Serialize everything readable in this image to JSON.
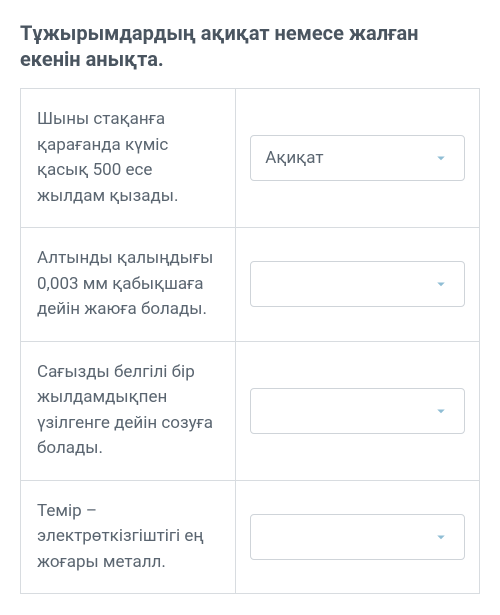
{
  "heading": "Тұжырымдардың ақиқат немесе жалған екенін анықта.",
  "rows": [
    {
      "text": "Шыны стақанға қарағанда күміс қасық 500 есе жылдам қызады.",
      "selected": "Ақиқат"
    },
    {
      "text": "Алтынды қалыңдығы 0,003 мм қабықшаға дейін жаюға болады.",
      "selected": ""
    },
    {
      "text": "Сағызды белгілі бір жылдамдықпен үзілгенге дейін созуға болады.",
      "selected": ""
    },
    {
      "text": "Темір – электрөткізгіштігі ең жоғары металл.",
      "selected": ""
    }
  ]
}
